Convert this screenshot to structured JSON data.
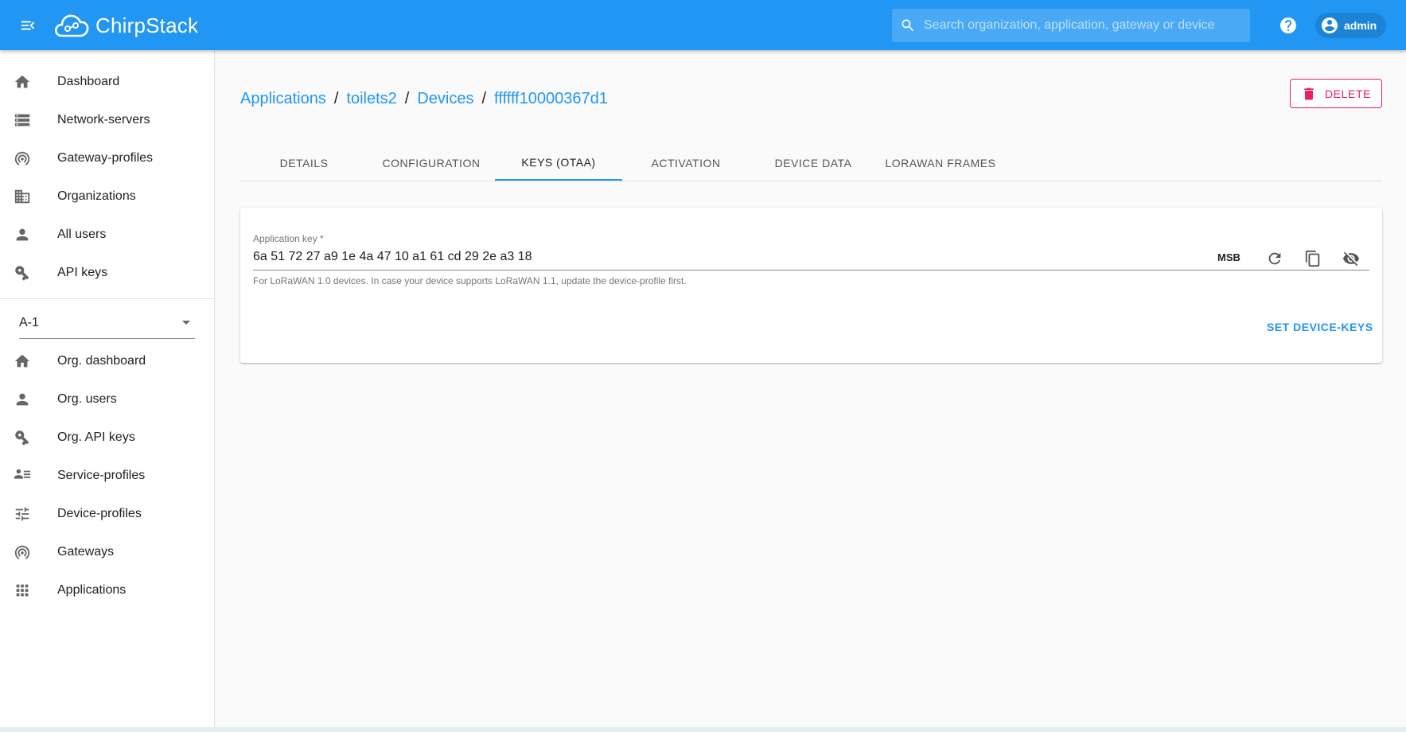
{
  "app": {
    "logo_text": "ChirpStack",
    "search_placeholder": "Search organization, application, gateway or device",
    "user_label": "admin"
  },
  "sidebar": {
    "global_items": [
      {
        "label": "Dashboard",
        "icon": "home-icon"
      },
      {
        "label": "Network-servers",
        "icon": "server-icon"
      },
      {
        "label": "Gateway-profiles",
        "icon": "wifi-tethering-icon"
      },
      {
        "label": "Organizations",
        "icon": "domain-icon"
      },
      {
        "label": "All users",
        "icon": "person-icon"
      },
      {
        "label": "API keys",
        "icon": "key-icon"
      }
    ],
    "organization_selected": "A-1",
    "org_items": [
      {
        "label": "Org. dashboard",
        "icon": "home-icon"
      },
      {
        "label": "Org. users",
        "icon": "person-icon"
      },
      {
        "label": "Org. API keys",
        "icon": "key-icon"
      },
      {
        "label": "Service-profiles",
        "icon": "account-details-icon"
      },
      {
        "label": "Device-profiles",
        "icon": "tune-icon"
      },
      {
        "label": "Gateways",
        "icon": "wifi-tethering-icon"
      },
      {
        "label": "Applications",
        "icon": "apps-icon"
      }
    ]
  },
  "breadcrumb": {
    "items": [
      "Applications",
      "toilets2",
      "Devices",
      "ffffff10000367d1"
    ],
    "separator": "/"
  },
  "actions": {
    "delete_label": "DELETE"
  },
  "tabs": [
    {
      "label": "DETAILS",
      "active": false
    },
    {
      "label": "CONFIGURATION",
      "active": false
    },
    {
      "label": "KEYS (OTAA)",
      "active": true
    },
    {
      "label": "ACTIVATION",
      "active": false
    },
    {
      "label": "DEVICE DATA",
      "active": false
    },
    {
      "label": "LORAWAN FRAMES",
      "active": false
    }
  ],
  "keys_form": {
    "app_key_label": "Application key *",
    "app_key_value": "6a 51 72 27 a9 1e 4a 47 10 a1 61 cd 29 2e a3 18",
    "byte_order": "MSB",
    "helper_text": "For LoRaWAN 1.0 devices. In case your device supports LoRaWAN 1.1, update the device-profile first.",
    "submit_label": "SET DEVICE-KEYS"
  },
  "colors": {
    "primary": "#2196f3",
    "danger": "#e91e63"
  }
}
